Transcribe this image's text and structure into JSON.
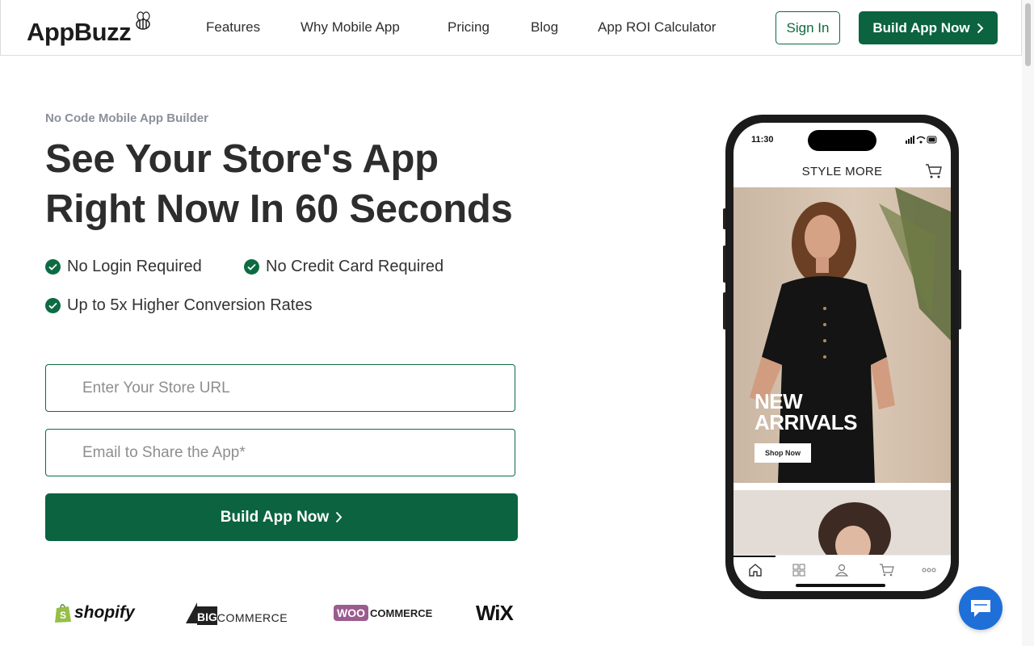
{
  "header": {
    "logo_text": "AppBuzz",
    "nav": [
      "Features",
      "Why Mobile App",
      "Pricing",
      "Blog",
      "App ROI Calculator"
    ],
    "signin_label": "Sign In",
    "build_label": "Build App Now"
  },
  "hero": {
    "eyebrow": "No Code Mobile App Builder",
    "headline_line1": "See Your Store's App",
    "headline_line2": "Right Now In 60 Seconds",
    "features": [
      "No Login Required",
      "No Credit Card Required",
      "Up to 5x Higher Conversion Rates"
    ],
    "store_url_placeholder": "Enter Your Store URL",
    "email_placeholder": "Email to Share the App*",
    "build_button": "Build App Now"
  },
  "platforms": [
    "shopify",
    "COMMERCE",
    "WOO",
    "COMMERCE",
    "WiX"
  ],
  "platform_big": "BIG",
  "phone": {
    "time": "11:30",
    "store_title": "STYLE MORE",
    "banner_line1": "NEW",
    "banner_line2": "ARRIVALS",
    "shop_now": "Shop Now"
  },
  "colors": {
    "brand_green": "#0b6340",
    "check_green": "#0d6b42",
    "chat_blue": "#1f6fd9"
  }
}
